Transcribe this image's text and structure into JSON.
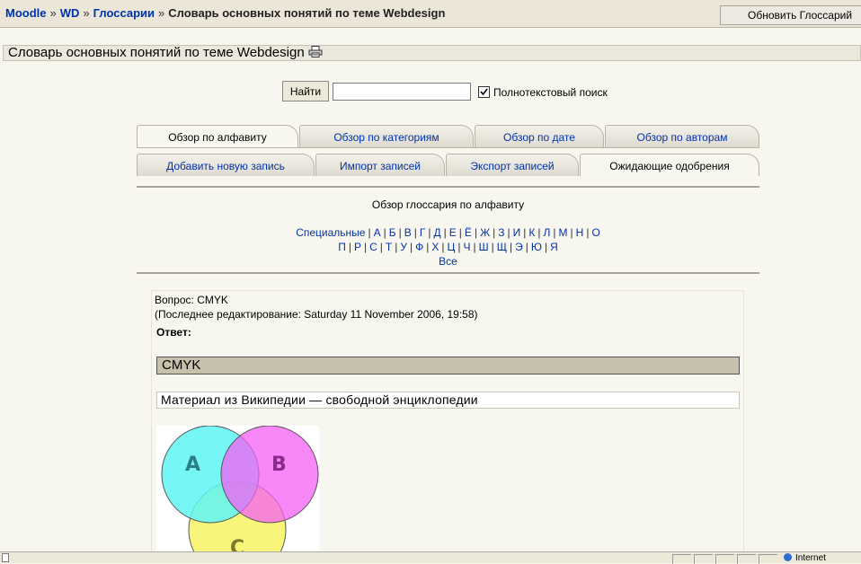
{
  "nav": {
    "crumbs": [
      "Moodle",
      "WD",
      "Глоссарии"
    ],
    "separator": "»",
    "current": "Словарь основных понятий по теме Webdesign",
    "update_button": "Обновить Глоссарий"
  },
  "heading": {
    "title": "Словарь основных понятий по теме Webdesign"
  },
  "search": {
    "button": "Найти",
    "value": "",
    "fulltext_label": "Полнотекстовый поиск",
    "fulltext_checked": true
  },
  "tabs": {
    "row1": [
      "Обзор по алфавиту",
      "Обзор по категориям",
      "Обзор по дате",
      "Обзор по авторам"
    ],
    "row2": [
      "Добавить новую запись",
      "Импорт записей",
      "Экспорт записей",
      "Ожидающие одобрения"
    ]
  },
  "alphabet": {
    "title": "Обзор глоссария по алфавиту",
    "special": "Специальные",
    "line1": [
      "А",
      "Б",
      "В",
      "Г",
      "Д",
      "Е",
      "Ё",
      "Ж",
      "З",
      "И",
      "К",
      "Л",
      "М",
      "Н",
      "О"
    ],
    "line2": [
      "П",
      "Р",
      "С",
      "Т",
      "У",
      "Ф",
      "Х",
      "Ц",
      "Ч",
      "Ш",
      "Щ",
      "Э",
      "Ю",
      "Я"
    ],
    "all": "Все"
  },
  "entry": {
    "question": "Вопрос: CMYK",
    "edited": "(Последнее редактирование: Saturday 11 November 2006, 19:58)",
    "answer_label": "Ответ:",
    "header": "CMYK",
    "source": "Материал из Википедии — свободной энциклопедии",
    "venn_labels": [
      "A",
      "B",
      "C"
    ]
  },
  "status": {
    "zone": "Internet"
  },
  "colors": {
    "link": "#0033aa",
    "cyan": "#5ff5f5",
    "magenta": "#f55ff5",
    "yellow": "#f7f57a"
  }
}
